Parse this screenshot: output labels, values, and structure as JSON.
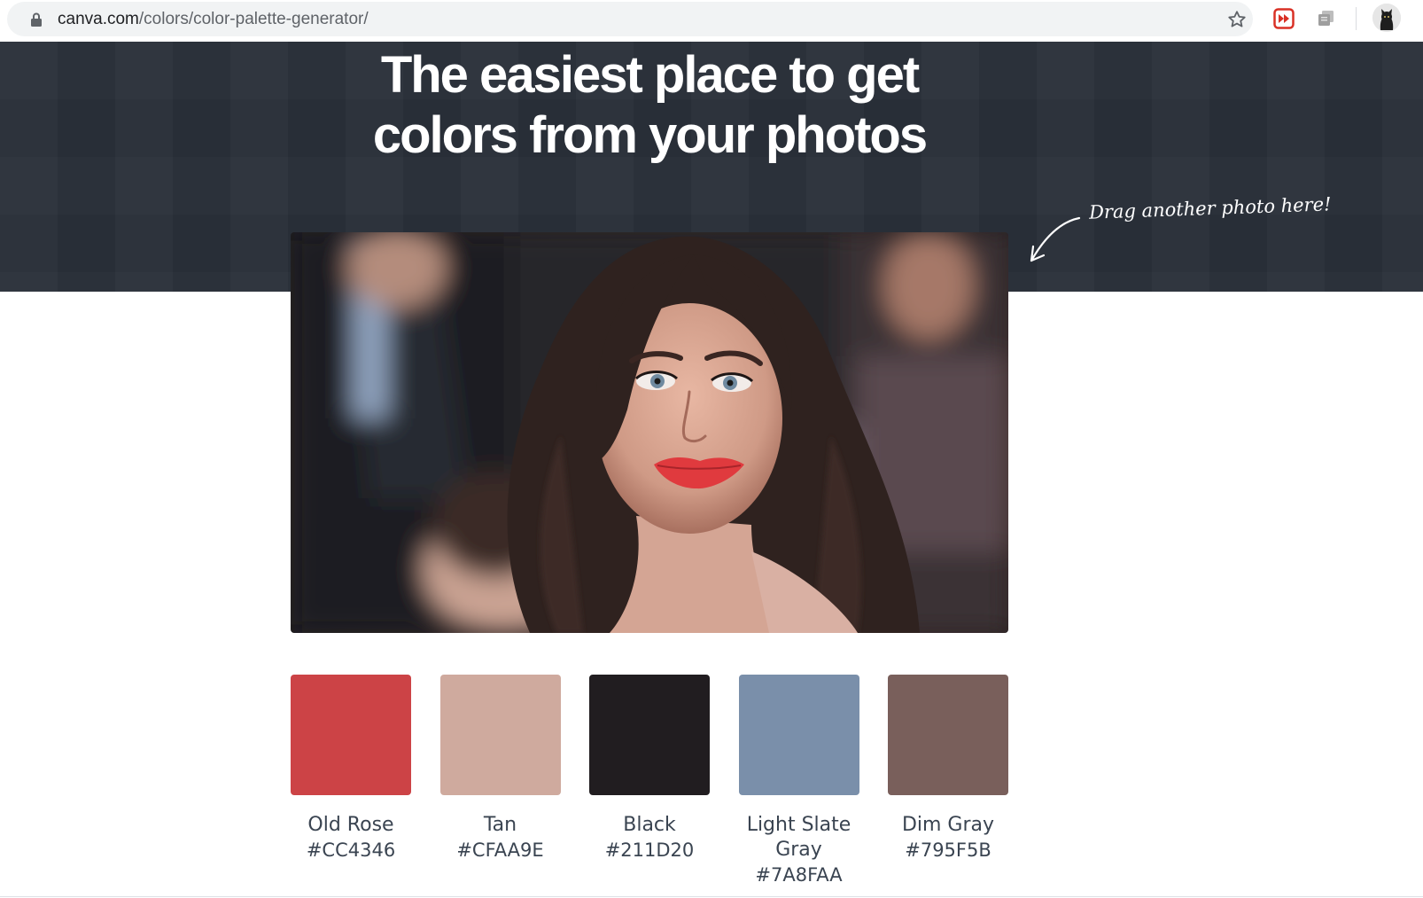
{
  "browser": {
    "url_host": "canva.com",
    "url_path": "/colors/color-palette-generator/"
  },
  "hero": {
    "title_line_1": "The easiest place to get",
    "title_line_2": "colors from your photos",
    "drag_hint": "Drag another photo here!"
  },
  "palette": {
    "colors": [
      {
        "name": "Old Rose",
        "hex": "#CC4346"
      },
      {
        "name": "Tan",
        "hex": "#CFAA9E"
      },
      {
        "name": "Black",
        "hex": "#211D20"
      },
      {
        "name": "Light Slate Gray",
        "hex": "#7A8FAA"
      },
      {
        "name": "Dim Gray",
        "hex": "#795F5B"
      }
    ]
  },
  "icons": {
    "lock": "lock-icon",
    "star": "star-icon",
    "extension_1": "fast-forward-extension-icon",
    "extension_2": "extension-icon"
  },
  "colors": {
    "hero_bg": "#2B313A",
    "text_dark": "#3A4451"
  }
}
